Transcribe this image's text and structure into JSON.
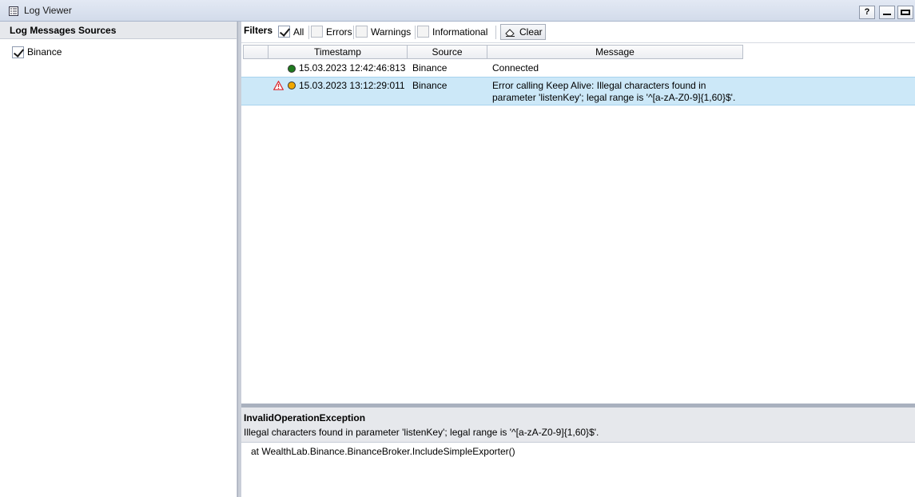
{
  "window": {
    "title": "Log Viewer",
    "help_label": "?",
    "min_label": "—",
    "max_label": "▭"
  },
  "sources": {
    "header": "Log Messages Sources",
    "items": [
      {
        "label": "Binance",
        "checked": true
      }
    ]
  },
  "filters": {
    "label": "Filters",
    "all": "All",
    "errors": "Errors",
    "warnings": "Warnings",
    "informational": "Informational",
    "clear": "Clear"
  },
  "grid": {
    "columns": [
      "Timestamp",
      "Source",
      "Message"
    ],
    "rows": [
      {
        "status": "ok",
        "status_color": "#1f7a1f",
        "warning": false,
        "timestamp": "15.03.2023 12:42:46:813",
        "source": "Binance",
        "message_line1": "Connected",
        "message_line2": ""
      },
      {
        "status": "warning",
        "status_color": "#f0a800",
        "warning": true,
        "timestamp": "15.03.2023 13:12:29:011",
        "source": "Binance",
        "message_line1": "Error calling Keep Alive: Illegal characters found in",
        "message_line2": "parameter 'listenKey'; legal range is '^[a-zA-Z0-9]{1,60}$'."
      }
    ]
  },
  "detail": {
    "exception": "InvalidOperationException",
    "message": "Illegal characters found in parameter 'listenKey'; legal range is '^[a-zA-Z0-9]{1,60}$'.",
    "trace": "at WealthLab.Binance.BinanceBroker.IncludeSimpleExporter()"
  },
  "colors": {
    "selected_row": "#cce8f8",
    "warning_icon": "#d9252b"
  }
}
